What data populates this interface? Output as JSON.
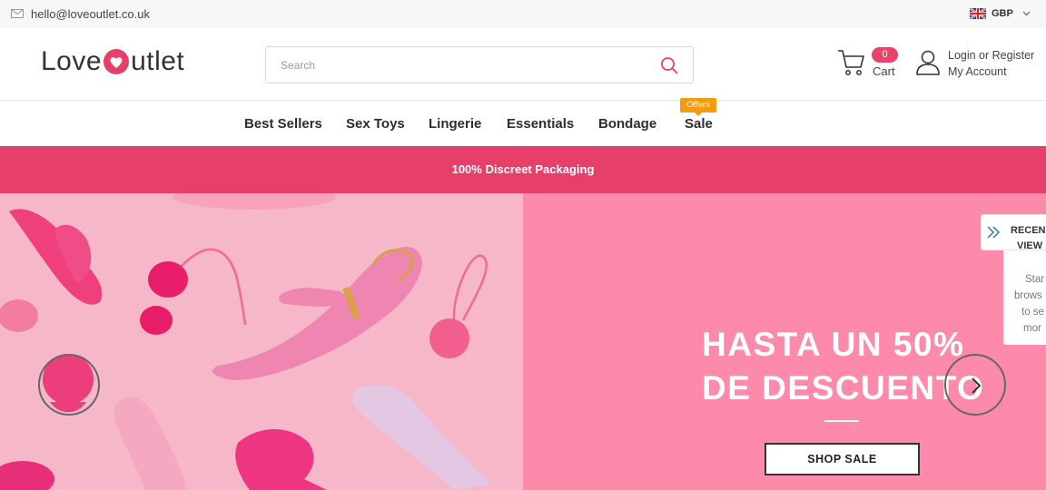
{
  "topbar": {
    "email": "hello@loveoutlet.co.uk",
    "currency": "GBP"
  },
  "header": {
    "logo": {
      "part1": "Love",
      "part2": "utlet"
    },
    "search": {
      "placeholder": "Search"
    },
    "cart": {
      "count": "0",
      "label": "Cart"
    },
    "account": {
      "login": "Login or Register",
      "my_account": "My Account"
    }
  },
  "nav": {
    "items": [
      "Best Sellers",
      "Sex Toys",
      "Lingerie",
      "Essentials",
      "Bondage",
      "Sale"
    ],
    "offers_badge": "Offers"
  },
  "promo": {
    "text": "100% Discreet Packaging"
  },
  "hero": {
    "headline_line1": "HASTA UN 50%",
    "headline_line2": "DE DESCUENTO",
    "cta": "SHOP SALE"
  },
  "recently_viewed": {
    "title_line1": "RECEN",
    "title_line2": "VIEW",
    "body_lines": [
      "Star",
      "brows",
      "to se",
      "mor"
    ]
  },
  "colors": {
    "accent": "#e53f6a",
    "hero_panel": "#fd8aab",
    "offers": "#f39c12"
  }
}
